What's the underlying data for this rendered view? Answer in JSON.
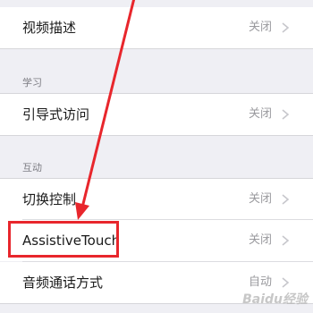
{
  "rows": [
    {
      "label": "视频描述",
      "value": "关闭"
    },
    {
      "label": "引导式访问",
      "value": "关闭"
    },
    {
      "label": "切换控制",
      "value": "关闭"
    },
    {
      "label": "AssistiveTouch",
      "value": "关闭"
    },
    {
      "label": "音频通话方式",
      "value": "自动"
    }
  ],
  "sections": {
    "learning": "学习",
    "interaction": "互动"
  },
  "watermark": "Baidu经验",
  "colors": {
    "highlight": "#e8262c",
    "arrow": "#e8262c",
    "background": "#efeff4"
  }
}
